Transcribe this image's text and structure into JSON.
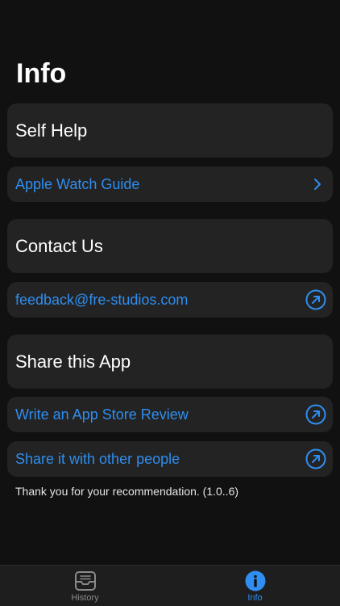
{
  "header": {
    "title": "Info"
  },
  "sections": {
    "self_help": {
      "title": "Self Help",
      "rows": [
        {
          "label": "Apple Watch Guide",
          "icon": "chevron-right-icon"
        }
      ]
    },
    "contact": {
      "title": "Contact Us",
      "rows": [
        {
          "label": "feedback@fre-studios.com",
          "icon": "external-link-icon"
        }
      ]
    },
    "share": {
      "title": "Share this App",
      "rows": [
        {
          "label": "Write an App Store Review",
          "icon": "external-link-icon"
        },
        {
          "label": "Share it with other people",
          "icon": "external-link-icon"
        }
      ]
    }
  },
  "footnote": "Thank you for your recommendation. (1.0..6)",
  "tabbar": {
    "tabs": [
      {
        "label": "History",
        "icon": "tray-icon",
        "selected": false
      },
      {
        "label": "Info",
        "icon": "info-icon",
        "selected": true
      }
    ]
  },
  "colors": {
    "background": "#111111",
    "card": "#232323",
    "accent": "#2f8ef0",
    "text": "#ffffff",
    "inactive_tab": "#8a8a8a"
  }
}
